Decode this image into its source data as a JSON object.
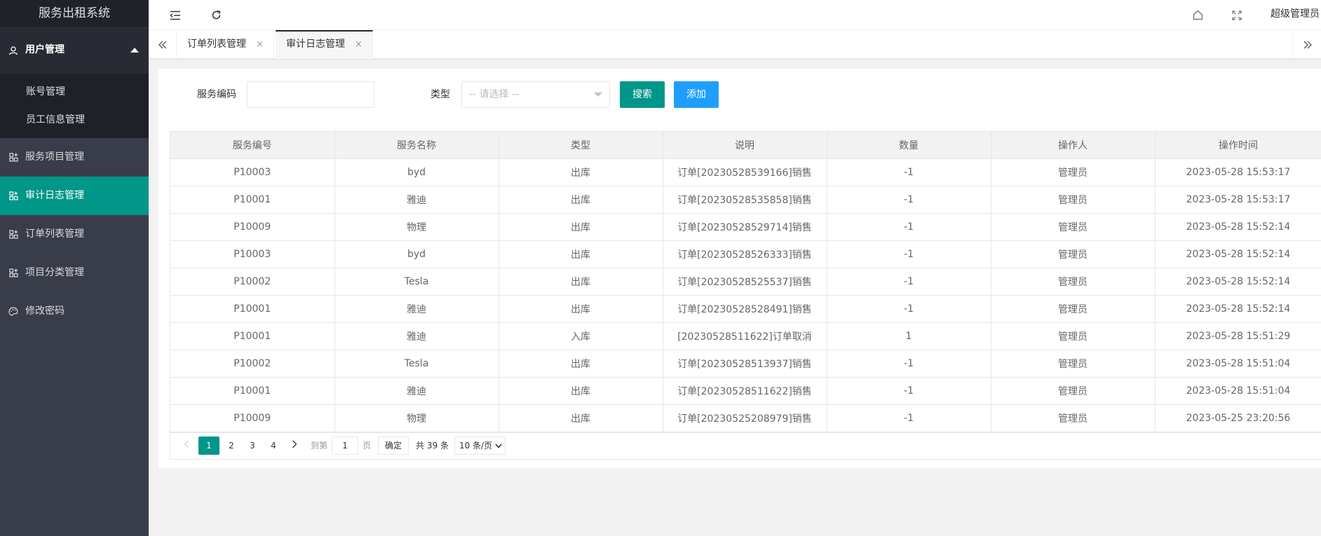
{
  "sidebar": {
    "logo": "服务出租系统",
    "user_menu": {
      "label": "用户管理",
      "children": [
        "账号管理",
        "员工信息管理"
      ]
    },
    "items": [
      "服务项目管理",
      "审计日志管理",
      "订单列表管理",
      "项目分类管理",
      "修改密码"
    ],
    "active_color": "#009688"
  },
  "header": {
    "admin_label": "超级管理员"
  },
  "tabs": [
    {
      "label": "订单列表管理",
      "close": "×"
    },
    {
      "label": "审计日志管理",
      "close": "×"
    }
  ],
  "filters": {
    "code_label": "服务编码",
    "code_value": "",
    "type_label": "类型",
    "type_placeholder": "-- 请选择 --",
    "search_label": "搜索",
    "add_label": "添加"
  },
  "table": {
    "headers": [
      "服务编号",
      "服务名称",
      "类型",
      "说明",
      "数量",
      "操作人",
      "操作时间"
    ],
    "rows": [
      [
        "P10003",
        "byd",
        "出库",
        "订单[20230528539166]销售",
        "-1",
        "管理员",
        "2023-05-28 15:53:17"
      ],
      [
        "P10001",
        "雅迪",
        "出库",
        "订单[20230528535858]销售",
        "-1",
        "管理员",
        "2023-05-28 15:53:17"
      ],
      [
        "P10009",
        "物理",
        "出库",
        "订单[20230528529714]销售",
        "-1",
        "管理员",
        "2023-05-28 15:52:14"
      ],
      [
        "P10003",
        "byd",
        "出库",
        "订单[20230528526333]销售",
        "-1",
        "管理员",
        "2023-05-28 15:52:14"
      ],
      [
        "P10002",
        "Tesla",
        "出库",
        "订单[20230528525537]销售",
        "-1",
        "管理员",
        "2023-05-28 15:52:14"
      ],
      [
        "P10001",
        "雅迪",
        "出库",
        "订单[20230528528491]销售",
        "-1",
        "管理员",
        "2023-05-28 15:52:14"
      ],
      [
        "P10001",
        "雅迪",
        "入库",
        "[20230528511622]订单取消",
        "1",
        "管理员",
        "2023-05-28 15:51:29"
      ],
      [
        "P10002",
        "Tesla",
        "出库",
        "订单[20230528513937]销售",
        "-1",
        "管理员",
        "2023-05-28 15:51:04"
      ],
      [
        "P10001",
        "雅迪",
        "出库",
        "订单[20230528511622]销售",
        "-1",
        "管理员",
        "2023-05-28 15:51:04"
      ],
      [
        "P10009",
        "物理",
        "出库",
        "订单[20230525208979]销售",
        "-1",
        "管理员",
        "2023-05-25 23:20:56"
      ]
    ]
  },
  "pagination": {
    "pages": [
      "1",
      "2",
      "3",
      "4"
    ],
    "current": "1",
    "goto_label": "到第",
    "goto_value": "1",
    "page_suffix": "页",
    "confirm_label": "确定",
    "total_text": "共 39 条",
    "page_size": "10 条/页"
  }
}
